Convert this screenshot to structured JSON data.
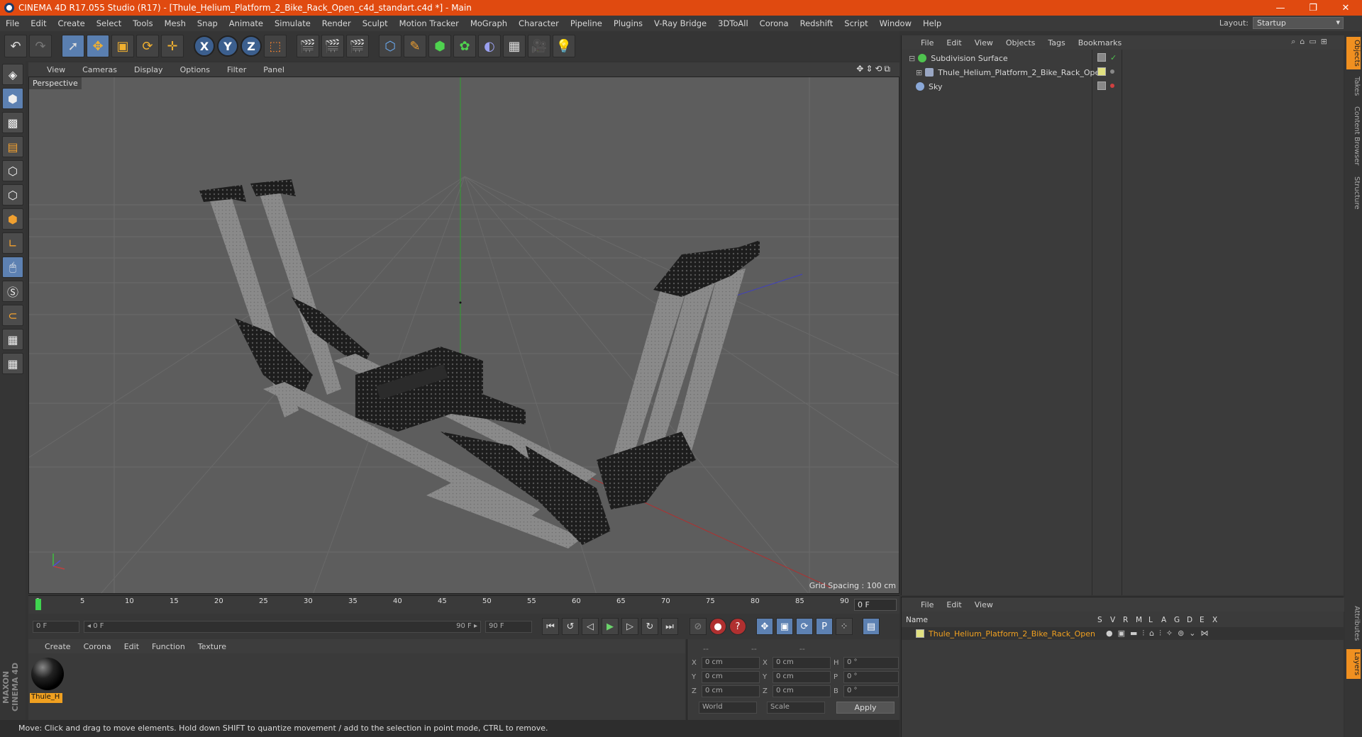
{
  "window": {
    "title": "CINEMA 4D R17.055 Studio (R17) - [Thule_Helium_Platform_2_Bike_Rack_Open_c4d_standart.c4d *] - Main",
    "controls": [
      "—",
      "❐",
      "✕"
    ]
  },
  "menubar": {
    "items": [
      "File",
      "Edit",
      "Create",
      "Select",
      "Tools",
      "Mesh",
      "Snap",
      "Animate",
      "Simulate",
      "Render",
      "Sculpt",
      "Motion Tracker",
      "MoGraph",
      "Character",
      "Pipeline",
      "Plugins",
      "V-Ray Bridge",
      "3DToAll",
      "Corona",
      "Redshift",
      "Script",
      "Window",
      "Help"
    ],
    "layout_label": "Layout:",
    "layout_value": "Startup"
  },
  "viewport": {
    "menu": [
      "View",
      "Cameras",
      "Display",
      "Options",
      "Filter",
      "Panel"
    ],
    "nav_icons": "✥⇕⟲⧉",
    "camera_label": "Perspective",
    "grid_spacing": "Grid Spacing : 100 cm"
  },
  "timeline": {
    "ticks": [
      "0",
      "5",
      "10",
      "15",
      "20",
      "25",
      "30",
      "35",
      "40",
      "45",
      "50",
      "55",
      "60",
      "65",
      "70",
      "75",
      "80",
      "85",
      "90"
    ],
    "current_frame": "0 F"
  },
  "transport": {
    "start": "0 F",
    "range_start": "◂ 0 F",
    "range_end": "90 F ▸",
    "end": "90 F"
  },
  "material_panel": {
    "menu": [
      "Create",
      "Corona",
      "Edit",
      "Function",
      "Texture"
    ],
    "material_name": "Thule_H"
  },
  "coords": {
    "header": [
      "--",
      "--",
      "--"
    ],
    "rows": [
      {
        "l1": "X",
        "v1": "0 cm",
        "l2": "X",
        "v2": "0 cm",
        "l3": "H",
        "v3": "0 °"
      },
      {
        "l1": "Y",
        "v1": "0 cm",
        "l2": "Y",
        "v2": "0 cm",
        "l3": "P",
        "v3": "0 °"
      },
      {
        "l1": "Z",
        "v1": "0 cm",
        "l2": "Z",
        "v2": "0 cm",
        "l3": "B",
        "v3": "0 °"
      }
    ],
    "mode_world": "World",
    "mode_scale": "Scale",
    "apply": "Apply"
  },
  "status": "Move: Click and drag to move elements. Hold down SHIFT to quantize movement / add to the selection in point mode, CTRL to remove.",
  "maxon_logo": "MAXON CINEMA 4D",
  "object_manager": {
    "menu": [
      "File",
      "Edit",
      "View",
      "Objects",
      "Tags",
      "Bookmarks"
    ],
    "objects": [
      {
        "name": "Subdivision Surface",
        "icon_color": "#4fc34f",
        "indent": 0
      },
      {
        "name": "Thule_Helium_Platform_2_Bike_Rack_Open",
        "icon_color": "#9aa7c4",
        "indent": 1
      },
      {
        "name": "Sky",
        "icon_color": "#8aa8d8",
        "indent": 0
      }
    ]
  },
  "layer_manager": {
    "menu": [
      "File",
      "Edit",
      "View"
    ],
    "columns": [
      "Name",
      "S",
      "V",
      "R",
      "M",
      "L",
      "A",
      "G",
      "D",
      "E",
      "X"
    ],
    "layer_name": "Thule_Helium_Platform_2_Bike_Rack_Open"
  },
  "right_tabs": [
    "Objects",
    "Takes",
    "Content Browser",
    "Structure",
    "Attributes",
    "Layers"
  ],
  "colors": {
    "titlebar": "#e04a10",
    "accent_orange": "#f0a020",
    "tool_blue": "#5d81b2"
  }
}
